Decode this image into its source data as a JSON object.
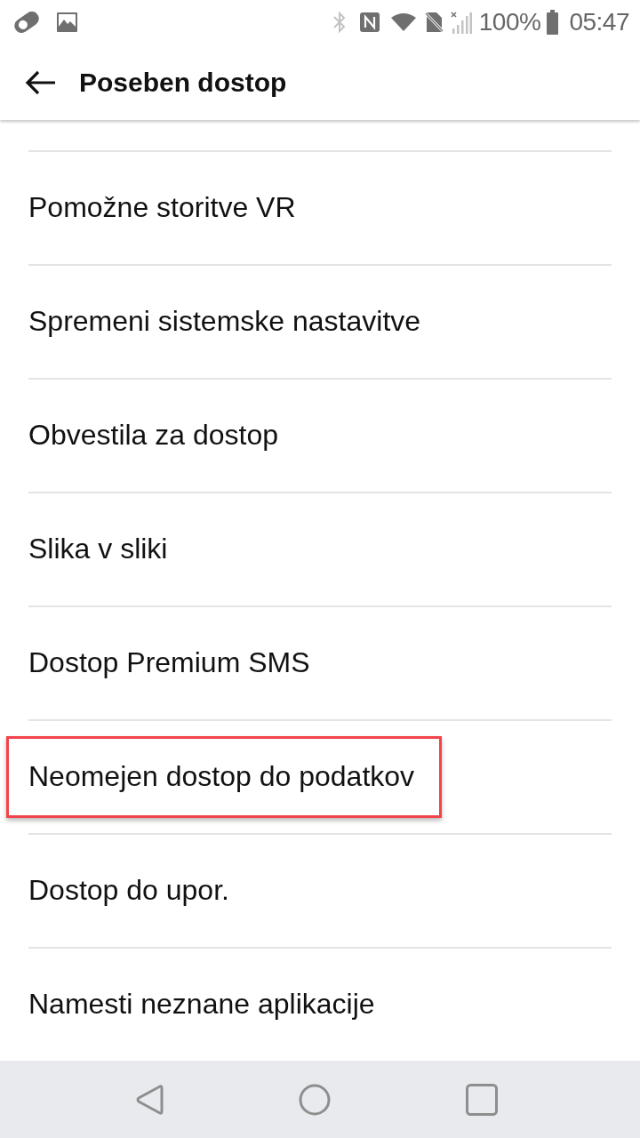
{
  "status_bar": {
    "battery_text": "100%",
    "time": "05:47"
  },
  "app_bar": {
    "title": "Poseben dostop"
  },
  "items": [
    {
      "label": "Pomožne storitve VR",
      "highlighted": false
    },
    {
      "label": "Spremeni sistemske nastavitve",
      "highlighted": false
    },
    {
      "label": "Obvestila za dostop",
      "highlighted": false
    },
    {
      "label": "Slika v sliki",
      "highlighted": false
    },
    {
      "label": "Dostop Premium SMS",
      "highlighted": false
    },
    {
      "label": "Neomejen dostop do podatkov",
      "highlighted": true
    },
    {
      "label": "Dostop do upor.",
      "highlighted": false
    },
    {
      "label": "Namesti neznane aplikacije",
      "highlighted": false
    }
  ]
}
